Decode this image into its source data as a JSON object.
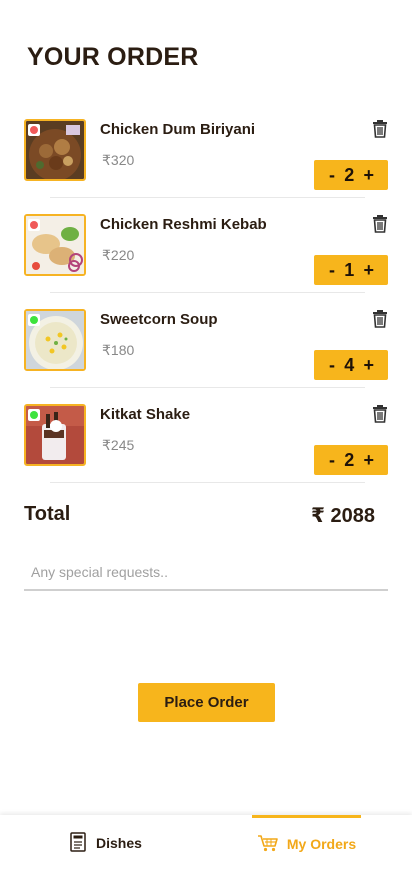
{
  "header": {
    "title": "YOUR ORDER"
  },
  "currency": "₹",
  "items": [
    {
      "name": "Chicken Dum Biriyani",
      "price": "₹320",
      "qty": "2",
      "veg": false
    },
    {
      "name": "Chicken Reshmi Kebab",
      "price": "₹220",
      "qty": "1",
      "veg": false
    },
    {
      "name": "Sweetcorn Soup",
      "price": "₹180",
      "qty": "4",
      "veg": true
    },
    {
      "name": "Kitkat Shake",
      "price": "₹245",
      "qty": "2",
      "veg": true
    }
  ],
  "stepper": {
    "minus": "-",
    "plus": "+"
  },
  "total": {
    "label": "Total",
    "value": "₹ 2088"
  },
  "special_request": {
    "placeholder": "Any special requests..",
    "value": ""
  },
  "place_order": {
    "label": "Place Order"
  },
  "nav": {
    "dishes": "Dishes",
    "orders": "My Orders"
  },
  "colors": {
    "accent": "#f7b51c",
    "nonveg": "#f05a5a",
    "veg": "#3ee33e",
    "text": "#2b1d12"
  }
}
